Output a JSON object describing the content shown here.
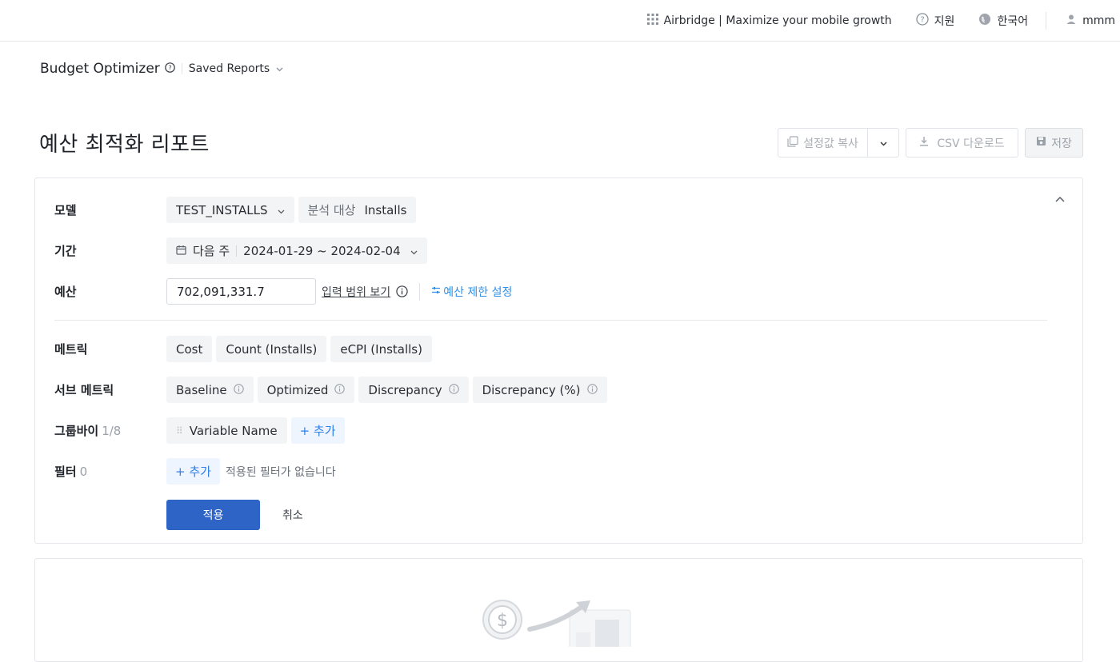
{
  "topbar": {
    "brand": "Airbridge | Maximize your mobile growth",
    "support": "지원",
    "language": "한국어",
    "user": "mmm"
  },
  "breadcrumb": {
    "title": "Budget Optimizer",
    "saved_reports": "Saved Reports"
  },
  "page": {
    "title": "예산 최적화 리포트"
  },
  "actions": {
    "copy_settings": "설정값 복사",
    "csv_download": "CSV 다운로드",
    "save": "저장"
  },
  "config": {
    "model": {
      "label": "모델",
      "value": "TEST_INSTALLS",
      "target_label": "분석 대상",
      "target_value": "Installs"
    },
    "period": {
      "label": "기간",
      "preset": "다음 주",
      "range": "2024-01-29 ~ 2024-02-04"
    },
    "budget": {
      "label": "예산",
      "value": "702,091,331.7",
      "range_link": "입력 범위 보기",
      "limit_link": "예산 제한 설정"
    },
    "metrics": {
      "label": "메트릭",
      "items": [
        "Cost",
        "Count (Installs)",
        "eCPI (Installs)"
      ]
    },
    "sub_metrics": {
      "label": "서브 메트릭",
      "items": [
        "Baseline",
        "Optimized",
        "Discrepancy",
        "Discrepancy (%)"
      ]
    },
    "group_by": {
      "label": "그룹바이",
      "count": "1/8",
      "items": [
        "Variable Name"
      ],
      "add": "+ 추가"
    },
    "filter": {
      "label": "필터",
      "count": "0",
      "add": "+ 추가",
      "empty": "적용된 필터가 없습니다"
    },
    "apply": "적용",
    "cancel": "취소"
  },
  "colors": {
    "primary": "#2f64c7",
    "link": "#2f8fea",
    "chip_bg": "#f3f4f6",
    "border": "#e3e6ea"
  }
}
